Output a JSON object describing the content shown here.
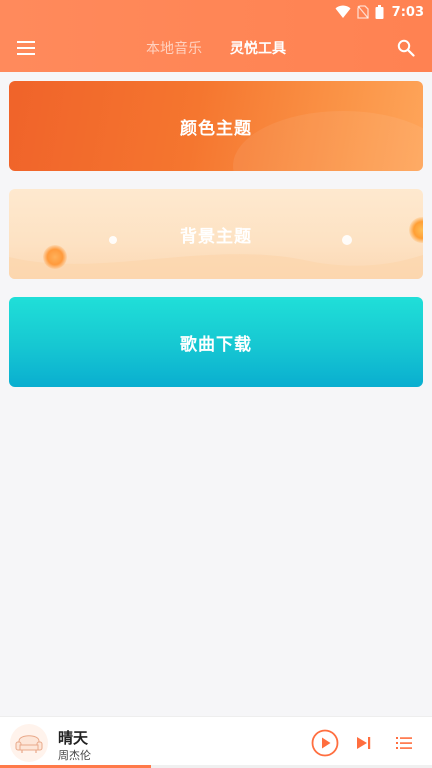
{
  "status_bar": {
    "time": "7:03"
  },
  "toolbar": {
    "tabs": [
      {
        "label": "本地音乐",
        "active": false
      },
      {
        "label": "灵悦工具",
        "active": true
      }
    ]
  },
  "cards": [
    {
      "label": "颜色主题"
    },
    {
      "label": "背景主题"
    },
    {
      "label": "歌曲下载"
    }
  ],
  "player": {
    "title": "晴天",
    "artist": "周杰伦",
    "progress": 0.35
  },
  "colors": {
    "accent": "#ff8656",
    "card_color": "#f5762f",
    "card_background": "#fde2c3",
    "card_song": "#16c7d2"
  }
}
